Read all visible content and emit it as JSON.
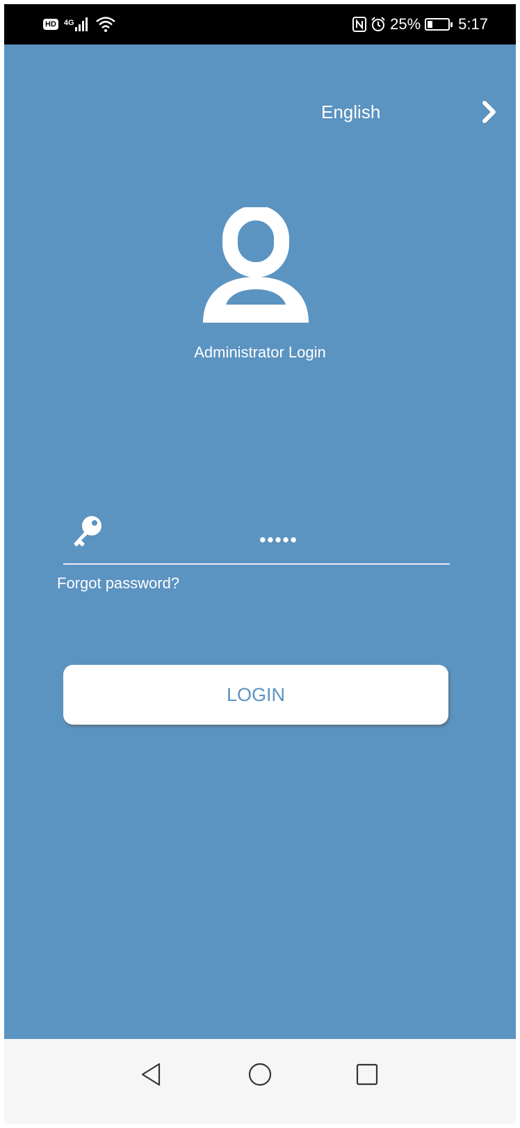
{
  "status_bar": {
    "hd": "HD",
    "network": "4G",
    "battery_percent": "25%",
    "battery_level": 0.25,
    "time": "5:17"
  },
  "language": {
    "label": "English",
    "icon": "chevron-right-icon"
  },
  "avatar": {
    "icon": "user-icon"
  },
  "title": "Administrator Login",
  "password": {
    "icon": "key-icon",
    "value": "•••••"
  },
  "forgot_password": "Forgot password?",
  "login_button": "LOGIN",
  "nav": {
    "back_icon": "back-triangle-icon",
    "home_icon": "home-circle-icon",
    "recents_icon": "recents-square-icon"
  },
  "colors": {
    "background": "#5b93c1",
    "button_text": "#5b93c1",
    "status_bar": "#000000",
    "nav_bar": "#f6f6f6"
  }
}
